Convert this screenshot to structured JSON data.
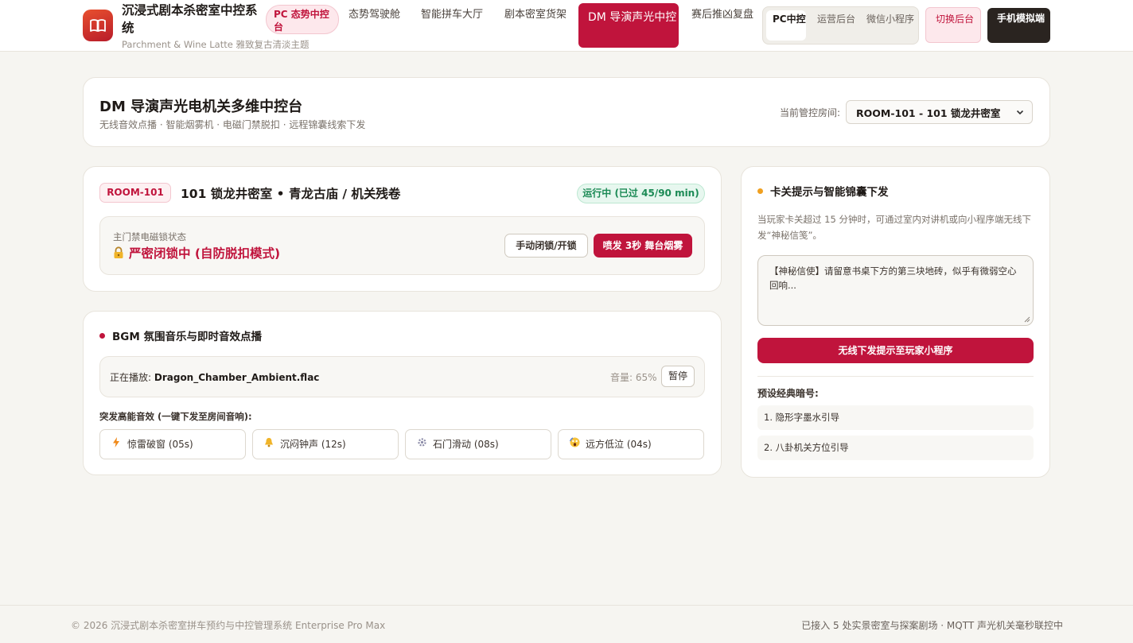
{
  "colors": {
    "accent": "#c0143c",
    "success": "#1b8a55",
    "background": "#f6f5f1",
    "dot_orange": "#f0a020"
  },
  "nav": {
    "logo_icon": "book-open-icon",
    "brand_title": "沉浸式剧本杀密室中控系统",
    "brand_subtitle": "Parchment & Wine Latte 雅致复古清淡主题",
    "badge": "PC 态势中控台",
    "items": [
      "态势驾驶舱",
      "智能拼车大厅",
      "剧本密室货架",
      "DM 导演声光中控",
      "赛后推凶复盘"
    ],
    "active_item": "DM 导演声光中控",
    "segment": [
      "PC中控",
      "运营后台",
      "微信小程序"
    ],
    "switch_button": "切换后台",
    "mobile_button": "手机模拟端"
  },
  "header": {
    "title": "DM 导演声光电机关多维中控台",
    "subtitle": "无线音效点播 · 智能烟雾机 · 电磁门禁脱扣 · 远程锦囊线索下发",
    "room_label": "当前管控房间:",
    "room_selected": "ROOM-101 - 101 锁龙井密室"
  },
  "room": {
    "tag": "ROOM-101",
    "title": "101 锁龙井密室 • 青龙古庙 / 机关残卷",
    "status": "运行中 (已过 45/90 min)",
    "lock_label": "主门禁电磁锁状态",
    "lock_icon": "lock-icon",
    "lock_state": "严密闭锁中 (自防脱扣模式)",
    "manual_button": "手动闭锁/开锁",
    "smoke_button": "喷发 3秒 舞台烟雾"
  },
  "bgm": {
    "title": "BGM 氛围音乐与即时音效点播",
    "now_playing_label": "正在播放:",
    "track": "Dragon_Chamber_Ambient.flac",
    "volume_text": "音量: 65%",
    "pause_button": "暂停",
    "sfx_label": "突发高能音效 (一键下发至房间音响):",
    "sfx": [
      {
        "icon": "lightning-icon",
        "label": "惊雷破窗 (05s)"
      },
      {
        "icon": "bell-icon",
        "label": "沉闷钟声 (12s)"
      },
      {
        "icon": "gear-icon",
        "label": "石门滑动 (08s)"
      },
      {
        "icon": "scream-face-icon",
        "label": "远方低泣 (04s)"
      }
    ]
  },
  "hint": {
    "title": "卡关提示与智能锦囊下发",
    "description": "当玩家卡关超过 15 分钟时，可通过室内对讲机或向小程序端无线下发“神秘信笺”。",
    "message": "【神秘信使】请留意书桌下方的第三块地砖，似乎有微弱空心回响...",
    "send_button": "无线下发提示至玩家小程序",
    "presets_title": "预设经典暗号:",
    "presets": [
      "1. 隐形字墨水引导",
      "2. 八卦机关方位引导"
    ]
  },
  "footer": {
    "left": "© 2026 沉浸式剧本杀密室拼车预约与中控管理系统 Enterprise Pro Max",
    "right": "已接入 5 处实景密室与探案剧场 · MQTT 声光机关毫秒联控中"
  }
}
